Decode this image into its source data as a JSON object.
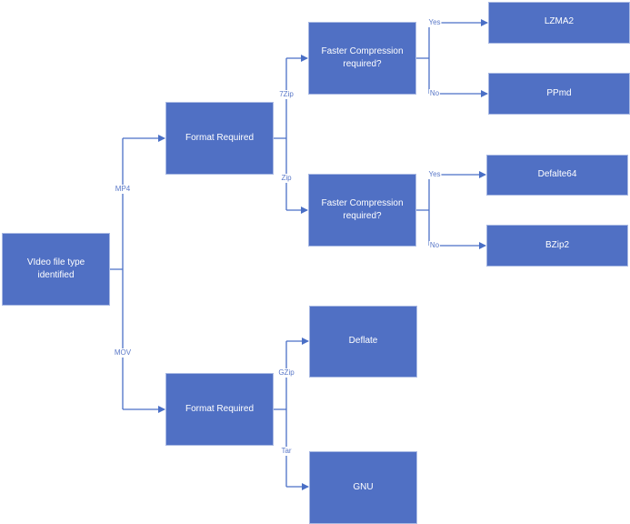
{
  "colors": {
    "box": "#5070c4",
    "connector": "#4a6fc6",
    "text": "#ffffff"
  },
  "nodes": {
    "video": "VIdeo file type identified",
    "format_mp4": "Format Required",
    "format_mov": "Format Required",
    "faster_7zip": "Faster Compression required?",
    "faster_zip": "Faster Compression required?",
    "lzma2": "LZMA2",
    "ppmd": "PPmd",
    "deflate64": "Defalte64",
    "bzip2": "BZip2",
    "deflate": "Deflate",
    "gnu": "GNU"
  },
  "edges": {
    "mp4": "MP4",
    "mov": "MOV",
    "zip7": "7Zip",
    "zip": "Zip",
    "gzip": "GZip",
    "tar": "Tar",
    "yes1": "Yes",
    "no1": "No",
    "yes2": "Yes",
    "no2": "No"
  }
}
